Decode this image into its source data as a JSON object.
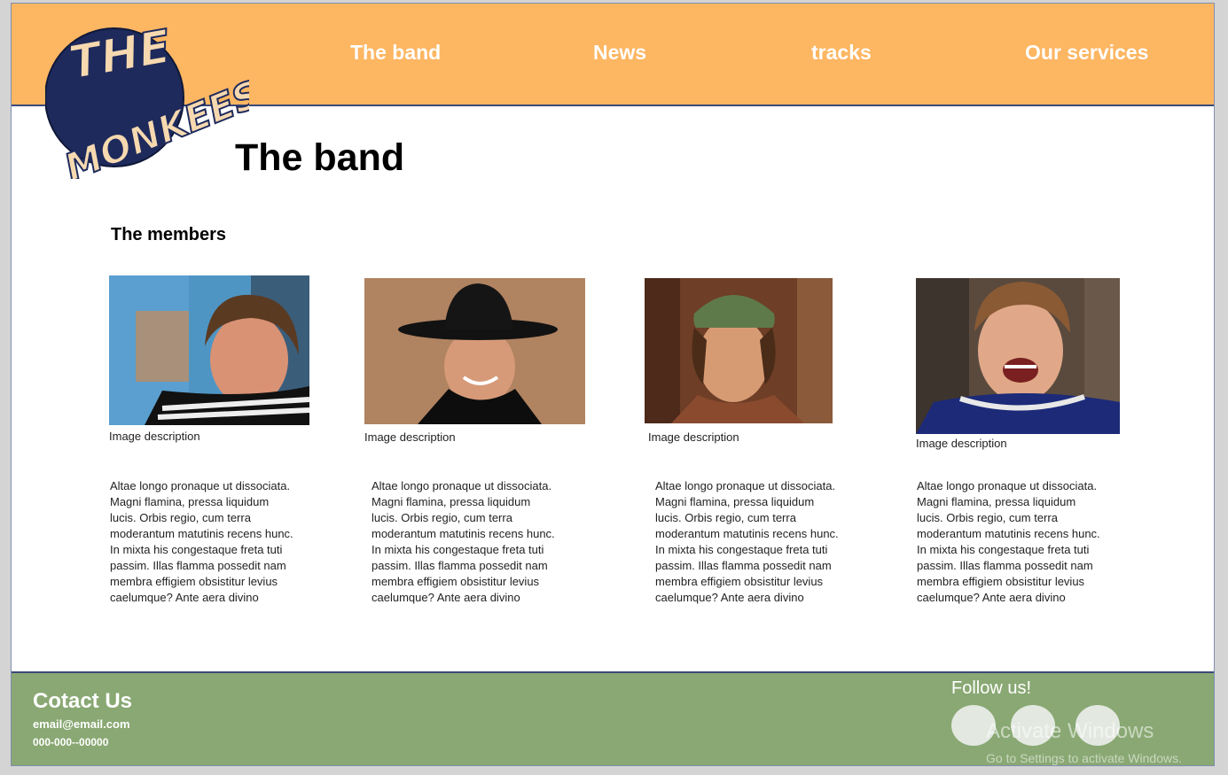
{
  "logo": {
    "line1": "THE",
    "line2": "MONKEES"
  },
  "nav": {
    "band": "The band",
    "news": "News",
    "tracks": "tracks",
    "services": "Our services"
  },
  "page_title": "The band",
  "section_heading": "The members",
  "members": [
    {
      "caption": "Image description",
      "bio": "Altae longo pronaque ut dissociata. Magni flamina, pressa liquidum lucis. Orbis regio, cum terra moderantum matutinis recens hunc. In mixta his congestaque freta tuti passim. Illas flamma possedit nam membra effigiem obsistitur levius caelumque? Ante aera divino"
    },
    {
      "caption": "Image description",
      "bio": "Altae longo pronaque ut dissociata. Magni flamina, pressa liquidum lucis. Orbis regio, cum terra moderantum matutinis recens hunc. In mixta his congestaque freta tuti passim. Illas flamma possedit nam membra effigiem obsistitur levius caelumque? Ante aera divino"
    },
    {
      "caption": "Image description",
      "bio": "Altae longo pronaque ut dissociata. Magni flamina, pressa liquidum lucis. Orbis regio, cum terra moderantum matutinis recens hunc. In mixta his congestaque freta tuti passim. Illas flamma possedit nam membra effigiem obsistitur levius caelumque? Ante aera divino"
    },
    {
      "caption": "Image description",
      "bio": "Altae longo pronaque ut dissociata. Magni flamina, pressa liquidum lucis. Orbis regio, cum terra moderantum matutinis recens hunc. In mixta his congestaque freta tuti passim. Illas flamma possedit nam membra effigiem obsistitur levius caelumque? Ante aera divino"
    }
  ],
  "footer": {
    "contact_title": "Cotact Us",
    "email": "email@email.com",
    "phone": "000-000--00000",
    "follow_title": "Follow us!"
  },
  "watermark": {
    "line1": "Activate Windows",
    "line2": "Go to Settings to activate Windows."
  },
  "colors": {
    "header": "#fdb662",
    "footer": "#89a873",
    "divider": "#3b4a7a",
    "logo_circle": "#1e2a5c",
    "logo_text": "#f7d9b0"
  },
  "icons": [
    "social-icon",
    "social-icon",
    "social-icon"
  ]
}
